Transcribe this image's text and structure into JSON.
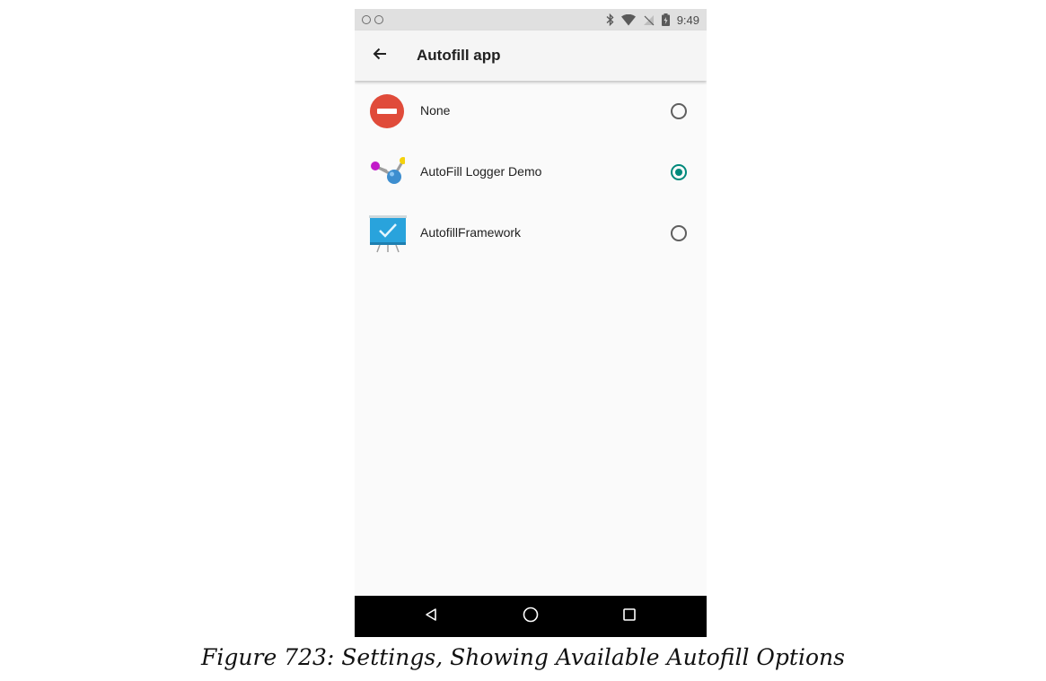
{
  "status_bar": {
    "time": "9:49",
    "icons": [
      "notification-dot-icon",
      "notification-dot-icon",
      "bluetooth-icon",
      "wifi-icon",
      "no-signal-icon",
      "battery-charging-icon"
    ]
  },
  "toolbar": {
    "back_icon": "arrow-left-icon",
    "title": "Autofill app"
  },
  "options": [
    {
      "label": "None",
      "icon": "do-not-enter-icon",
      "selected": false
    },
    {
      "label": "AutoFill Logger Demo",
      "icon": "molecule-app-icon",
      "selected": true
    },
    {
      "label": "AutofillFramework",
      "icon": "presentation-board-icon",
      "selected": false
    }
  ],
  "nav_bar": {
    "buttons": [
      "back-triangle-icon",
      "home-circle-icon",
      "recents-square-icon"
    ]
  },
  "caption": "Figure 723: Settings, Showing Available Autofill Options",
  "colors": {
    "accent": "#00897b",
    "toolbar_bg": "#f5f5f5",
    "status_bg": "#e0e0e0",
    "nav_bg": "#000000",
    "none_icon_red": "#e04b3a"
  }
}
